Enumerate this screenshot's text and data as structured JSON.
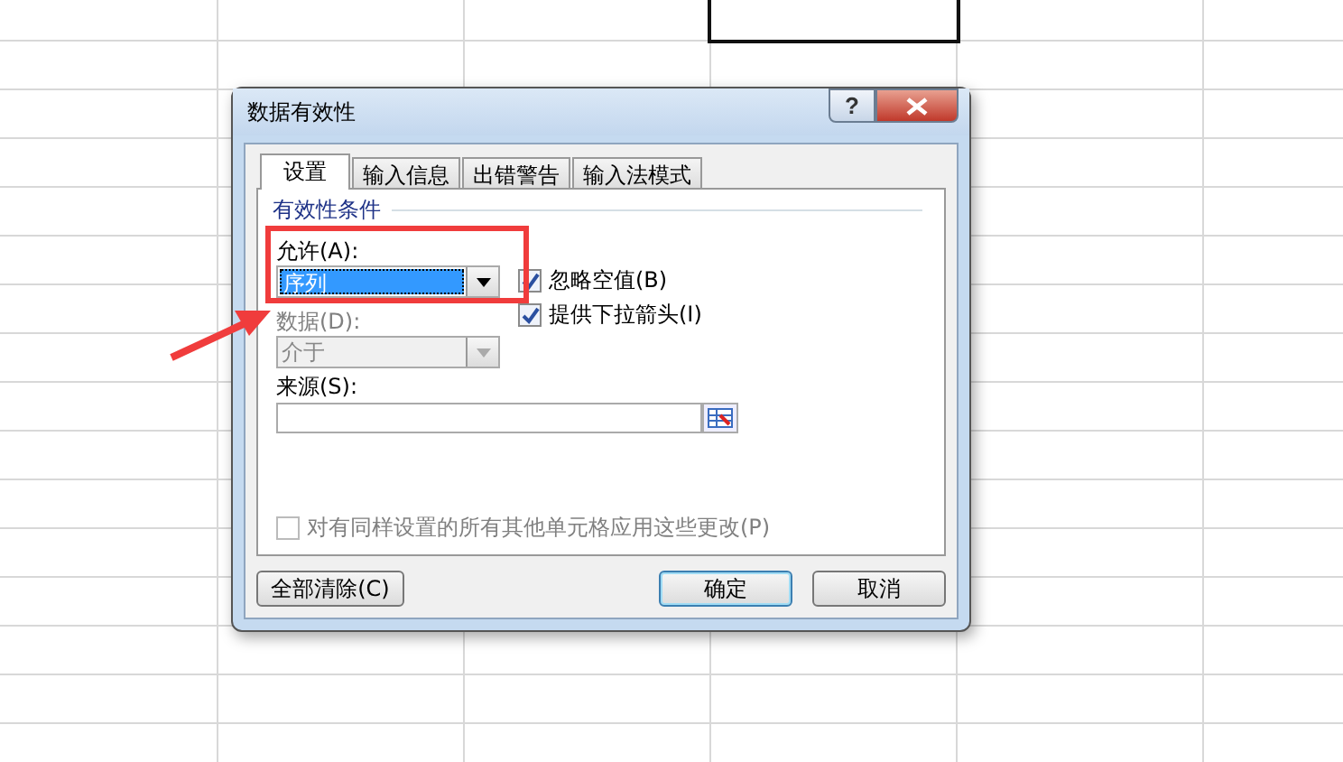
{
  "dialog": {
    "title": "数据有效性",
    "help_button": "?",
    "tabs": [
      {
        "label": "设置",
        "selected": true
      },
      {
        "label": "输入信息",
        "selected": false
      },
      {
        "label": "出错警告",
        "selected": false
      },
      {
        "label": "输入法模式",
        "selected": false
      }
    ],
    "group_title": "有效性条件",
    "allow": {
      "label": "允许(A):",
      "value": "序列"
    },
    "options": [
      {
        "label": "忽略空值(B)",
        "checked": true
      },
      {
        "label": "提供下拉箭头(I)",
        "checked": true
      }
    ],
    "data": {
      "label": "数据(D):",
      "value": "介于",
      "disabled": true
    },
    "source": {
      "label": "来源(S):"
    },
    "apply_all": {
      "label": "对有同样设置的所有其他单元格应用这些更改(P)",
      "checked": false,
      "disabled": true
    },
    "clear_button": "全部清除(C)",
    "ok_button": "确定",
    "cancel_button": "取消"
  }
}
